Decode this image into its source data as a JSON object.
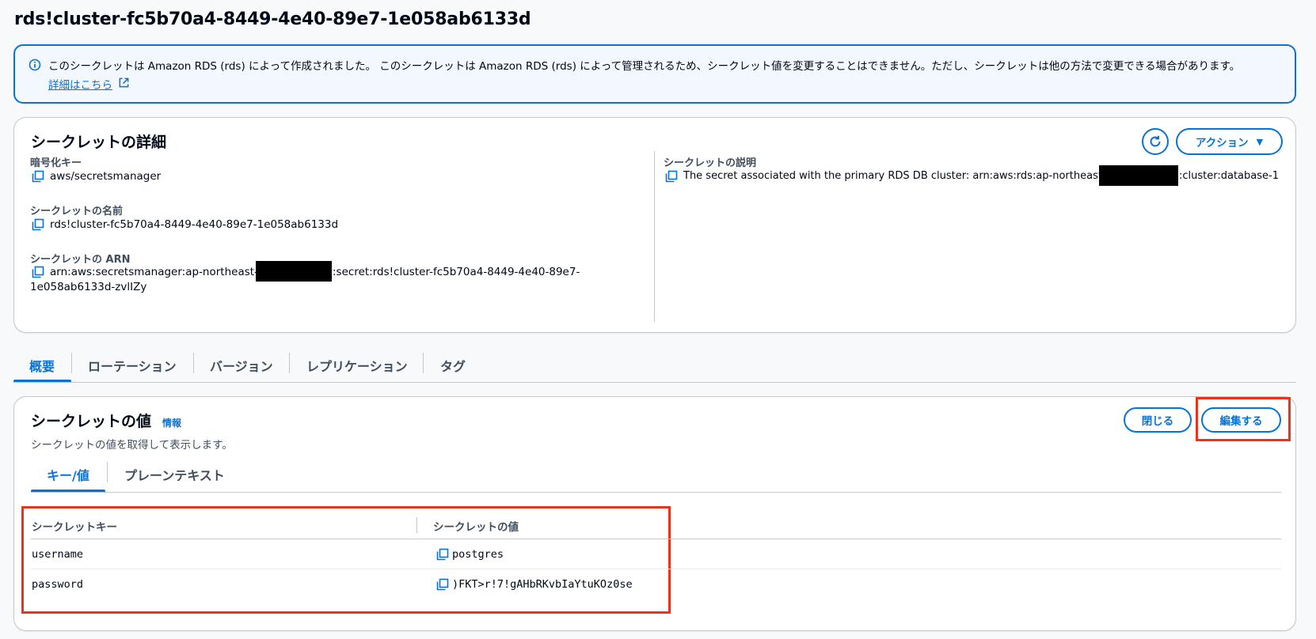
{
  "page": {
    "title": "rds!cluster-fc5b70a4-8449-4e40-89e7-1e058ab6133d"
  },
  "alert": {
    "text": "このシークレットは Amazon RDS (rds) によって作成されました。 このシークレットは Amazon RDS (rds) によって管理されるため、シークレット値を変更することはできません。ただし、シークレットは他の方法で変更できる場合があります。",
    "link": "詳細はこちら"
  },
  "details": {
    "title": "シークレットの詳細",
    "action_label": "アクション",
    "encryption_key": {
      "label": "暗号化キー",
      "value": "aws/secretsmanager"
    },
    "secret_name": {
      "label": "シークレットの名前",
      "value": "rds!cluster-fc5b70a4-8449-4e40-89e7-1e058ab6133d"
    },
    "secret_arn": {
      "label": "シークレットの ARN",
      "value_prefix": "arn:aws:secretsmanager:ap-northeast-1:",
      "value_suffix": ":secret:rds!cluster-fc5b70a4-8449-4e40-89e7-",
      "value_line2": "1e058ab6133d-zvlIZy"
    },
    "description": {
      "label": "シークレットの説明",
      "value_prefix": "The secret associated with the primary RDS DB cluster: arn:aws:rds:ap-northeast-1:",
      "value_suffix": ":cluster:database-1"
    }
  },
  "tabs": [
    {
      "label": "概要"
    },
    {
      "label": "ローテーション"
    },
    {
      "label": "バージョン"
    },
    {
      "label": "レプリケーション"
    },
    {
      "label": "タグ"
    }
  ],
  "secret_value": {
    "title": "シークレットの値",
    "info": "情報",
    "subtitle": "シークレットの値を取得して表示します。",
    "close_label": "閉じる",
    "edit_label": "編集する",
    "inner_tabs": [
      {
        "label": "キー/値"
      },
      {
        "label": "プレーンテキスト"
      }
    ],
    "columns": {
      "key": "シークレットキー",
      "value": "シークレットの値"
    },
    "rows": [
      {
        "key": "username",
        "value": "postgres"
      },
      {
        "key": "password",
        "value": ")FKT>r!7!gAHbRKvbIaYtuKOz0se"
      }
    ]
  },
  "colors": {
    "accent": "#0972d3",
    "highlight": "#e8341c"
  }
}
